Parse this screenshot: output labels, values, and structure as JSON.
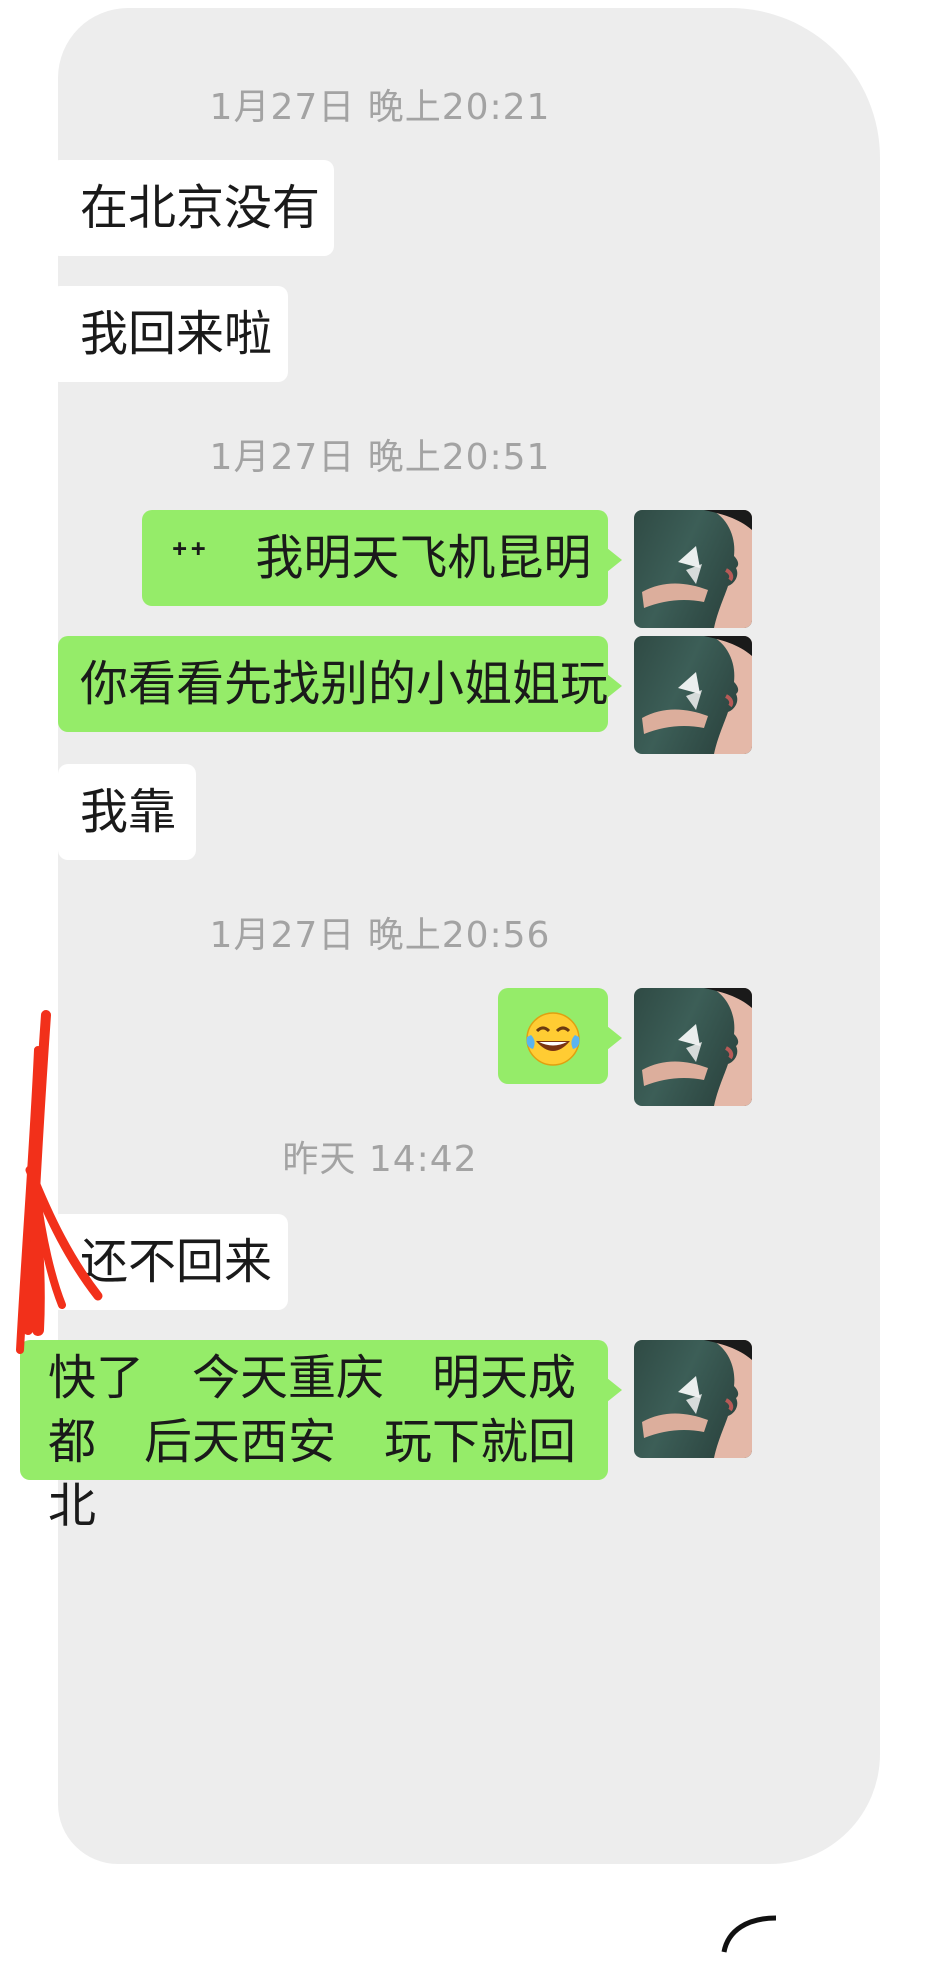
{
  "timestamps": [
    "1月27日 晚上20:21",
    "1月27日 晚上20:51",
    "1月27日 晚上20:56",
    "昨天 14:42"
  ],
  "messages": [
    {
      "side": "incoming",
      "text": "在北京没有"
    },
    {
      "side": "incoming",
      "text": "我回来啦"
    },
    {
      "side": "outgoing",
      "text": "ᐩᐩ　我明天飞机昆明"
    },
    {
      "side": "outgoing",
      "text": "你看看先找别的小姐姐玩"
    },
    {
      "side": "incoming",
      "text": "我靠"
    },
    {
      "side": "outgoing",
      "emoji": "tears-of-joy-emoji"
    },
    {
      "side": "incoming",
      "text": "还不回来"
    },
    {
      "side": "outgoing",
      "line1": "快了　今天重庆　明天成",
      "line2": "都　后天西安　玩下就回北"
    }
  ],
  "colors": {
    "chat_background": "#ededed",
    "incoming_bubble": "#ffffff",
    "outgoing_bubble": "#95ec69",
    "timestamp_text": "#a3a3a3",
    "annotation_mark": "#f2301a"
  },
  "avatar_icon": "woman-with-butterfly-avatar"
}
